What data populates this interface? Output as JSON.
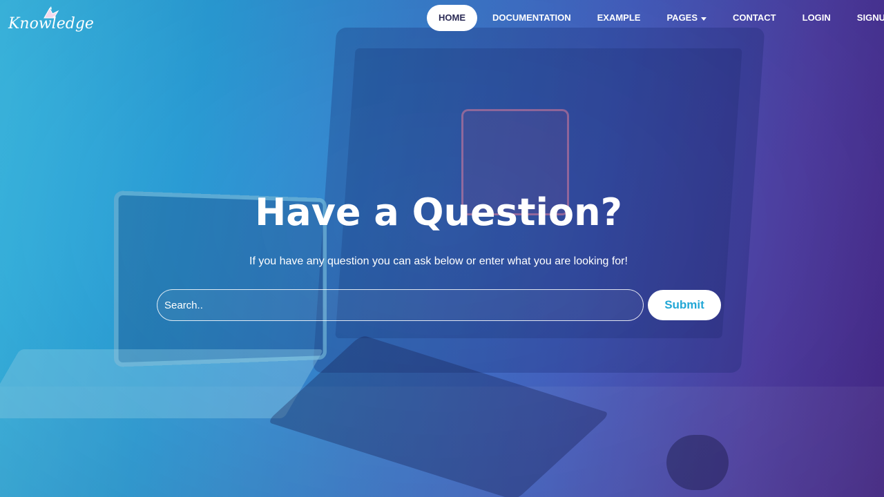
{
  "logo": {
    "text": "Knowledge",
    "icon": "bird-logo-icon"
  },
  "nav": {
    "items": [
      {
        "label": "HOME",
        "active": true
      },
      {
        "label": "DOCUMENTATION",
        "active": false
      },
      {
        "label": "EXAMPLE",
        "active": false
      },
      {
        "label": "PAGES",
        "active": false,
        "dropdown": true
      },
      {
        "label": "CONTACT",
        "active": false
      },
      {
        "label": "LOGIN",
        "active": false
      },
      {
        "label": "SIGNUP",
        "active": false
      }
    ]
  },
  "hero": {
    "title": "Have a Question?",
    "subtitle": "If you have any question you can ask below or enter what you are looking for!",
    "search": {
      "placeholder": "Search..",
      "value": ""
    },
    "submit_label": "Submit"
  },
  "colors": {
    "gradient_start": "#3fc6ee",
    "gradient_end": "#4a2a8c",
    "accent": "#22a7d6",
    "active_nav_text": "#2a2a55"
  }
}
